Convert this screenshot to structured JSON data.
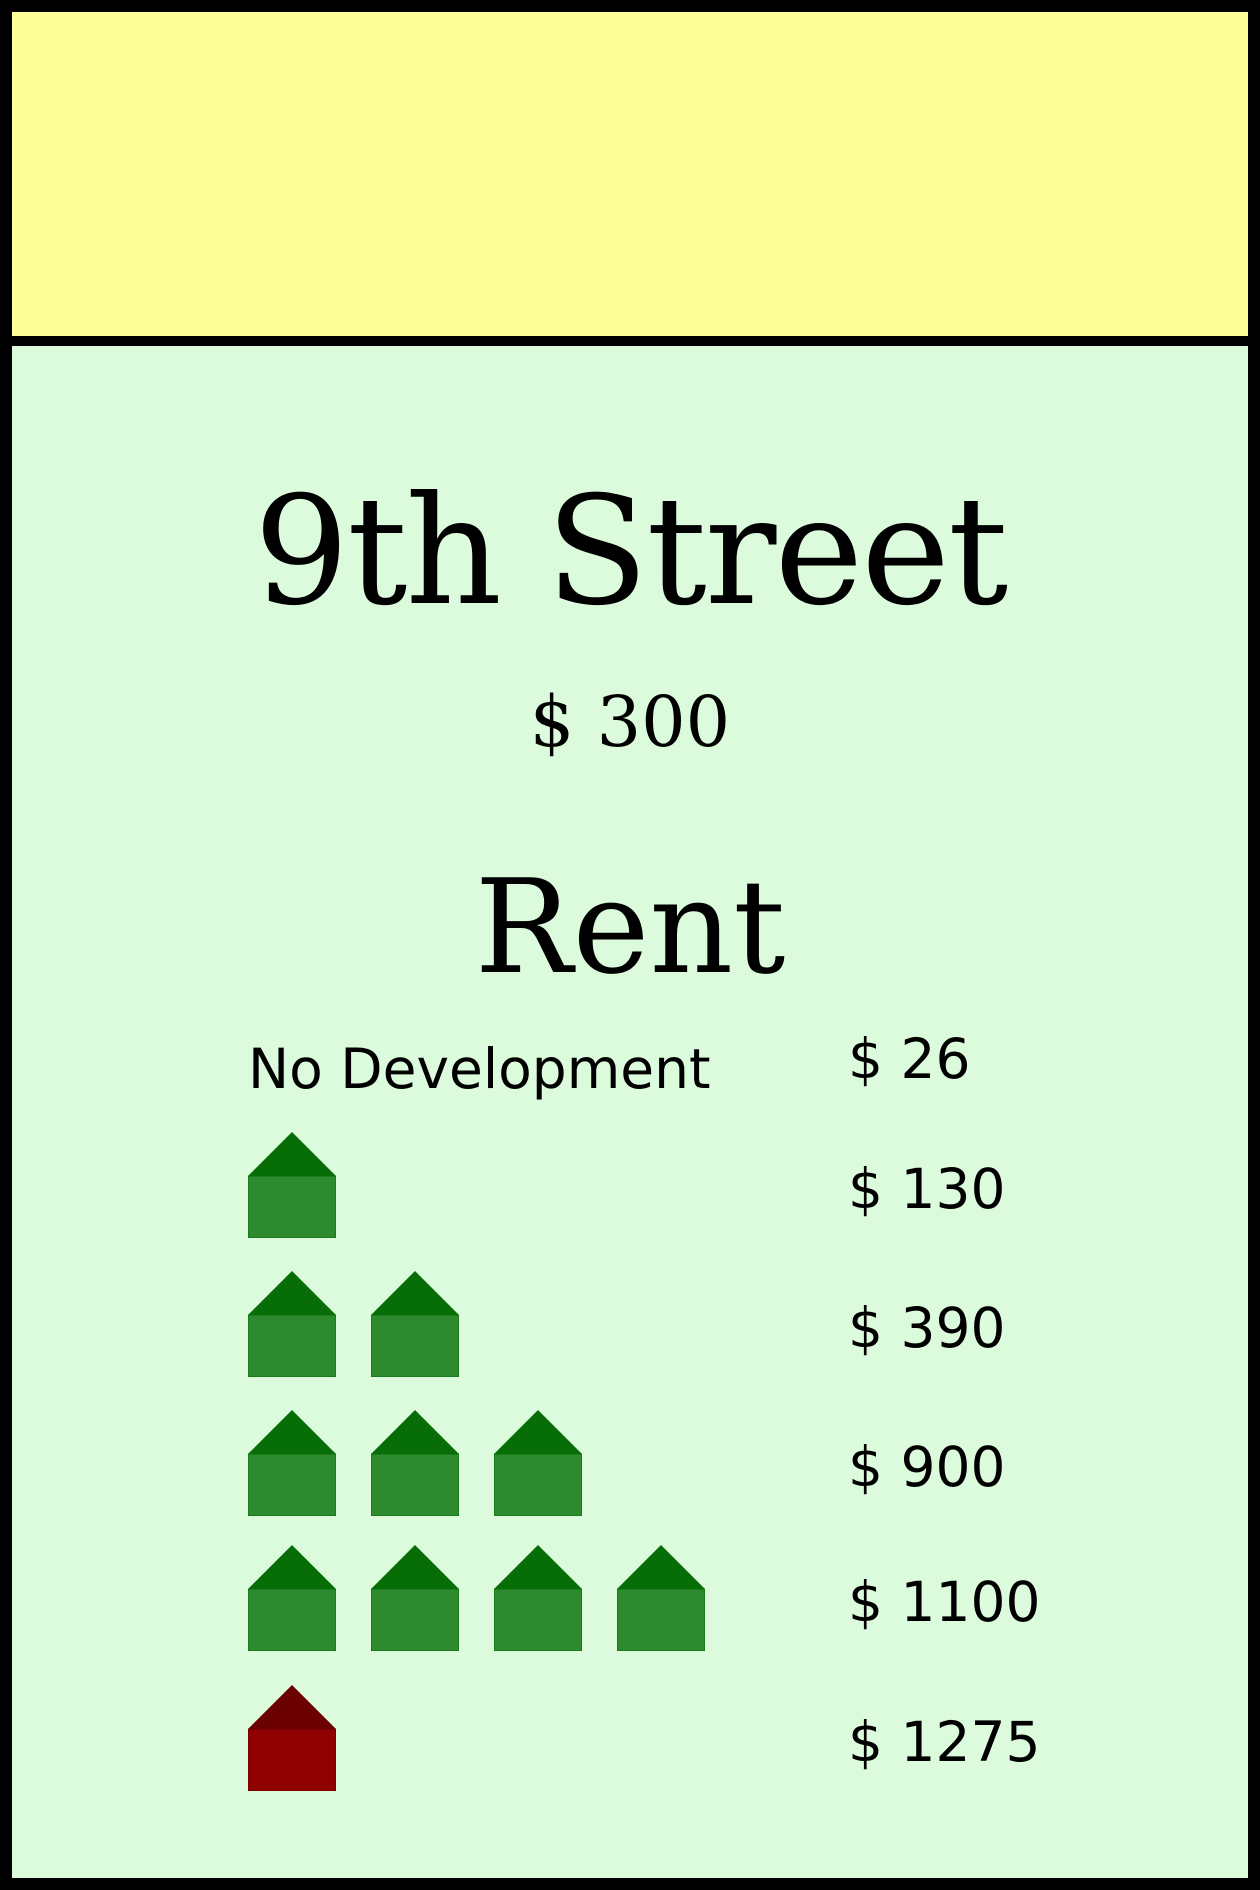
{
  "card": {
    "title": "9th Street",
    "price": "$ 300",
    "rent_heading": "Rent",
    "band_color": "#ffff99",
    "background_color": "#dcfadc"
  },
  "rent_rows": [
    {
      "label": "No Development",
      "houses": 0,
      "hotel": false,
      "value": "$ 26"
    },
    {
      "label": "",
      "houses": 1,
      "hotel": false,
      "value": "$ 130"
    },
    {
      "label": "",
      "houses": 2,
      "hotel": false,
      "value": "$ 390"
    },
    {
      "label": "",
      "houses": 3,
      "hotel": false,
      "value": "$ 900"
    },
    {
      "label": "",
      "houses": 4,
      "hotel": false,
      "value": "$ 1100"
    },
    {
      "label": "",
      "houses": 0,
      "hotel": true,
      "value": "$ 1275"
    }
  ],
  "icons": {
    "house": "house-icon",
    "hotel": "hotel-icon"
  },
  "colors": {
    "house_body": "#2e8a2e",
    "house_roof": "#076e07",
    "hotel_body": "#8f0000",
    "hotel_roof": "#6b0000"
  }
}
